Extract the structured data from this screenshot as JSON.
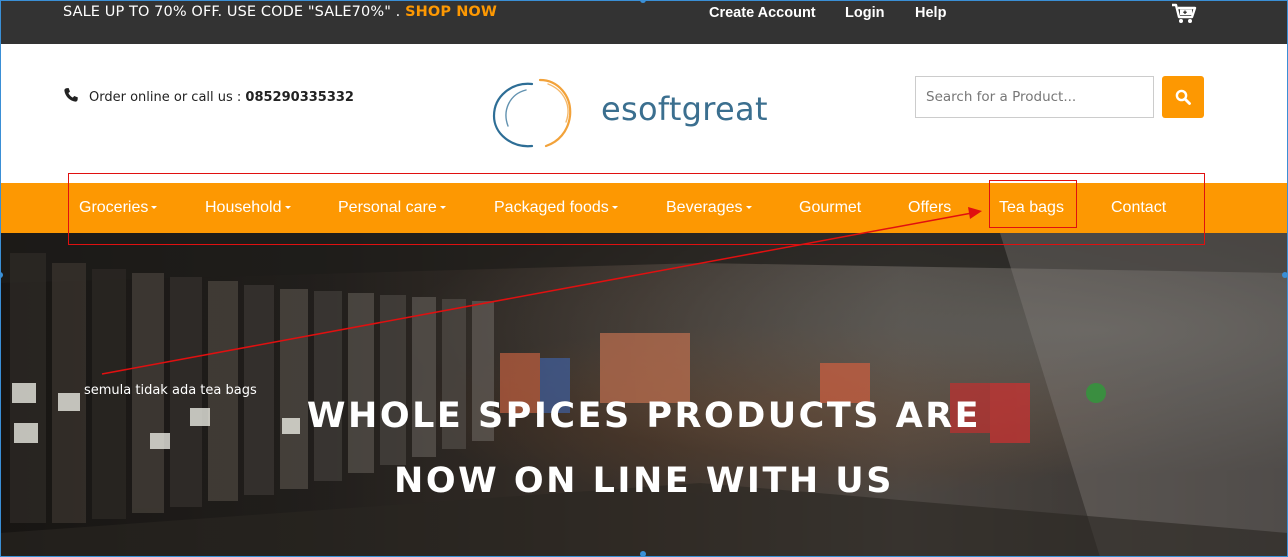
{
  "topbar": {
    "promo_text": "SALE UP TO 70% OFF. USE CODE \"SALE70%\" . ",
    "promo_link": "SHOP NOW",
    "links": [
      "Create Account",
      "Login",
      "Help"
    ],
    "cart_icon": "cart-icon"
  },
  "header": {
    "phone_icon": "phone-icon",
    "phone_label": "Order online or call us : ",
    "phone_number": "085290335332",
    "logo_text": "esoftgreat",
    "search_placeholder": "Search for a Product...",
    "search_icon": "search-icon"
  },
  "nav": {
    "items": [
      {
        "label": "Groceries",
        "dropdown": true
      },
      {
        "label": "Household",
        "dropdown": true
      },
      {
        "label": "Personal care",
        "dropdown": true
      },
      {
        "label": "Packaged foods",
        "dropdown": true
      },
      {
        "label": "Beverages",
        "dropdown": true
      },
      {
        "label": "Gourmet",
        "dropdown": false
      },
      {
        "label": "Offers",
        "dropdown": false
      },
      {
        "label": "Tea bags",
        "dropdown": false
      },
      {
        "label": "Contact",
        "dropdown": false
      }
    ]
  },
  "hero": {
    "title_line1": "WHOLE SPICES PRODUCTS ARE",
    "title_line2": "NOW ON LINE WITH US"
  },
  "annotation": {
    "note": "semula tidak ada tea bags"
  },
  "colors": {
    "accent": "#fd9802",
    "topbar_bg": "#333333",
    "annotation": "#e01010",
    "logo_blue": "#3b6f8f"
  }
}
